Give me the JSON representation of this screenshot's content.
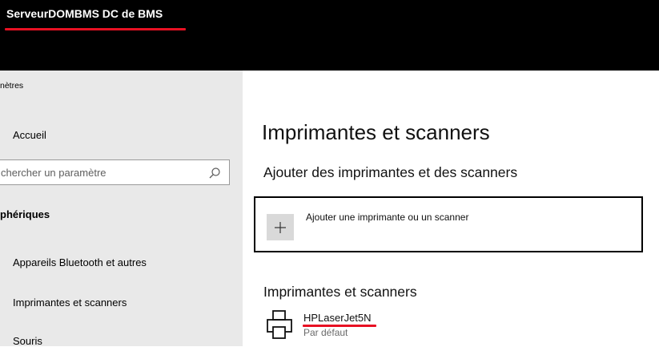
{
  "window": {
    "title": "ServeurDOMBMS DC de BMS"
  },
  "sidebar": {
    "app_title": "nètres",
    "home_label": "Accueil",
    "search": {
      "placeholder": "chercher un paramètre"
    },
    "section_heading": "phériques",
    "items": [
      {
        "label": "Appareils Bluetooth et autres"
      },
      {
        "label": "Imprimantes et scanners"
      },
      {
        "label": "Souris"
      }
    ]
  },
  "main": {
    "title": "Imprimantes et scanners",
    "add_heading": "Ajouter des imprimantes et des scanners",
    "add_button_label": "Ajouter une imprimante ou un scanner",
    "list_heading": "Imprimantes et scanners",
    "printers": [
      {
        "name": "HPLaserJet5N",
        "status": "Par défaut",
        "icon": "printer-icon"
      }
    ]
  },
  "colors": {
    "titlebar": "#000000",
    "sidebar": "#e9e9e9",
    "annotation_underline": "#e81123",
    "plus_tile": "#d9d9d9"
  },
  "icons": {
    "search": "search-icon",
    "add": "plus-icon",
    "printer": "printer-icon"
  }
}
